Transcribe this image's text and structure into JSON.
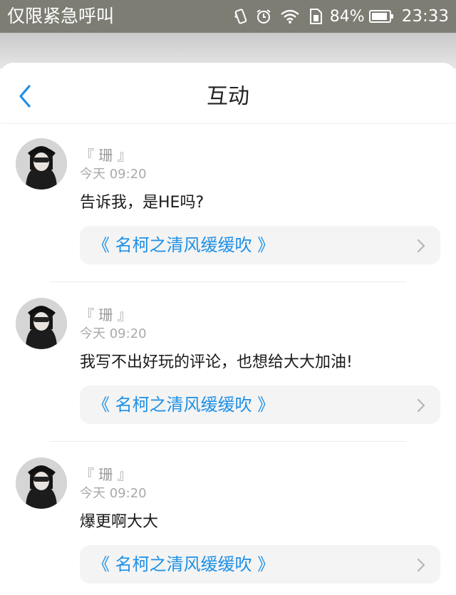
{
  "status_bar": {
    "carrier": "仅限紧急呼叫",
    "battery": "84%",
    "time": "23:33",
    "icons": [
      "vibrate-icon",
      "alarm-icon",
      "wifi-icon",
      "sim-icon",
      "battery-icon"
    ]
  },
  "nav": {
    "title": "互动",
    "back_icon": "chevron-left-icon"
  },
  "colors": {
    "accent": "#1e90e6",
    "status_bar": "#7d7d74",
    "card_background": "#f4f4f4"
  },
  "items": [
    {
      "username": "『 珊 』",
      "time": "今天 09:20",
      "comment": "告诉我，是HE吗?",
      "book": "《 名柯之清风缓缓吹 》"
    },
    {
      "username": "『 珊 』",
      "time": "今天 09:20",
      "comment": "我写不出好玩的评论，也想给大大加油!",
      "book": "《 名柯之清风缓缓吹 》"
    },
    {
      "username": "『 珊 』",
      "time": "今天 09:20",
      "comment": "爆更啊大大",
      "book": "《 名柯之清风缓缓吹 》"
    }
  ]
}
